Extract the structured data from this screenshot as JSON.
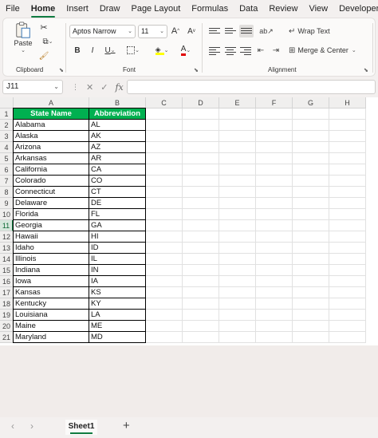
{
  "menu": {
    "items": [
      {
        "label": "File"
      },
      {
        "label": "Home"
      },
      {
        "label": "Insert"
      },
      {
        "label": "Draw"
      },
      {
        "label": "Page Layout"
      },
      {
        "label": "Formulas"
      },
      {
        "label": "Data"
      },
      {
        "label": "Review"
      },
      {
        "label": "View"
      },
      {
        "label": "Developer"
      }
    ],
    "active_index": 1
  },
  "ribbon": {
    "clipboard": {
      "paste_label": "Paste",
      "group_label": "Clipboard"
    },
    "font": {
      "font_name": "Aptos Narrow",
      "font_size": "11",
      "group_label": "Font",
      "bold": "B",
      "italic": "I",
      "underline": "U",
      "grow": "A",
      "shrink": "A"
    },
    "alignment": {
      "wrap_text": "Wrap Text",
      "merge_center": "Merge & Center",
      "group_label": "Alignment"
    }
  },
  "formula_bar": {
    "name_box": "J11",
    "fx": "fx",
    "formula": ""
  },
  "columns": [
    "A",
    "B",
    "C",
    "D",
    "E",
    "F",
    "G",
    "H"
  ],
  "rows": [
    "1",
    "2",
    "3",
    "4",
    "5",
    "6",
    "7",
    "8",
    "9",
    "10",
    "11",
    "12",
    "13",
    "14",
    "15",
    "16",
    "17",
    "18",
    "19",
    "20",
    "21"
  ],
  "selected_row": "11",
  "table": {
    "headers": [
      "State Name",
      "Abbreviation"
    ],
    "rows": [
      [
        "Alabama",
        "AL"
      ],
      [
        "Alaska",
        "AK"
      ],
      [
        "Arizona",
        "AZ"
      ],
      [
        "Arkansas",
        "AR"
      ],
      [
        "California",
        "CA"
      ],
      [
        "Colorado",
        "CO"
      ],
      [
        "Connecticut",
        "CT"
      ],
      [
        "Delaware",
        "DE"
      ],
      [
        "Florida",
        "FL"
      ],
      [
        "Georgia",
        "GA"
      ],
      [
        "Hawaii",
        "HI"
      ],
      [
        "Idaho",
        "ID"
      ],
      [
        "Illinois",
        "IL"
      ],
      [
        "Indiana",
        "IN"
      ],
      [
        "Iowa",
        "IA"
      ],
      [
        "Kansas",
        "KS"
      ],
      [
        "Kentucky",
        "KY"
      ],
      [
        "Louisiana",
        "LA"
      ],
      [
        "Maine",
        "ME"
      ],
      [
        "Maryland",
        "MD"
      ]
    ]
  },
  "sheets": {
    "tabs": [
      "Sheet1"
    ],
    "add_label": "+",
    "prev": "‹",
    "next": "›"
  },
  "colors": {
    "accent": "#107c41",
    "header_fill": "#00b050"
  }
}
